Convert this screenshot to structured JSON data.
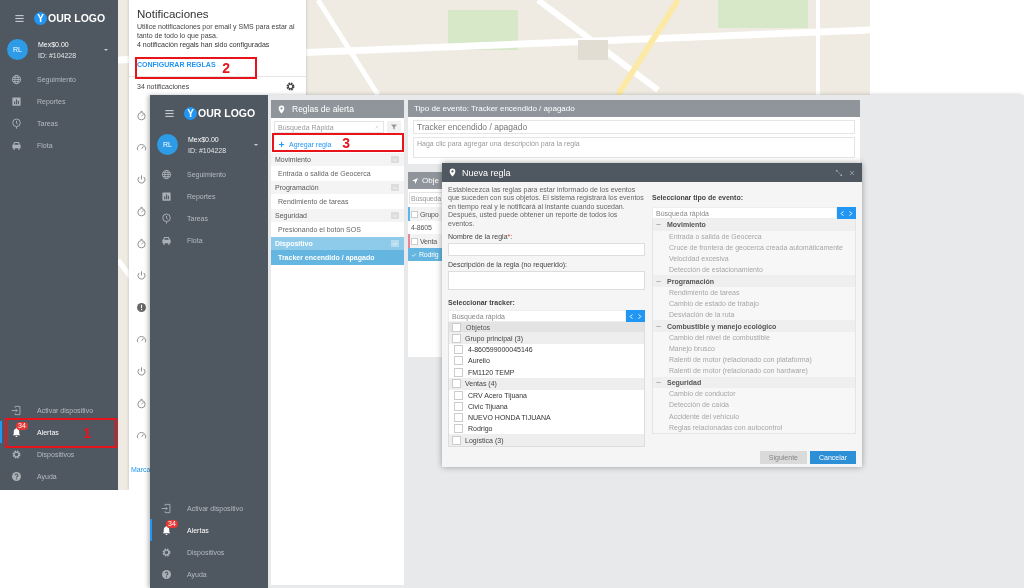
{
  "screen_1": {
    "sidebar": {
      "logo": {
        "mark": "Y",
        "text": "OUR LOGO"
      },
      "account": {
        "initials": "RL",
        "balance": "Mex$0.00",
        "id": "ID: #104228"
      },
      "nav": [
        {
          "label": "Seguimiento",
          "selected": false
        },
        {
          "label": "Reportes",
          "selected": false
        },
        {
          "label": "Tareas",
          "selected": false
        },
        {
          "label": "Flota",
          "selected": false
        }
      ],
      "bottom_nav": [
        {
          "label": "Activar dispositivo",
          "selected": false
        },
        {
          "label": "Alertas",
          "selected": true,
          "badge": "34"
        },
        {
          "label": "Dispositivos",
          "selected": false
        },
        {
          "label": "Ayuda",
          "selected": false
        }
      ]
    },
    "notifications": {
      "title": "Notificaciones",
      "description": "Utilice notificaciones por email y SMS para estar al tanto de todo lo que pasa.",
      "status": "4 notificación regals han sido configuradas",
      "link": "CONFIGURAR REGLAS",
      "count": "34 notificaciones",
      "rows": [
        {
          "kind": "timer"
        },
        {
          "kind": "gauge"
        },
        {
          "kind": "power"
        },
        {
          "kind": "timer"
        },
        {
          "kind": "timer"
        },
        {
          "kind": "power"
        },
        {
          "kind": "info"
        },
        {
          "kind": "gauge"
        },
        {
          "kind": "power"
        },
        {
          "kind": "timer"
        },
        {
          "kind": "gauge"
        }
      ],
      "footer_link": "Marca"
    }
  },
  "screen_2": {
    "sidebar": {
      "logo": {
        "mark": "Y",
        "text": "OUR LOGO"
      },
      "account": {
        "initials": "RL",
        "balance": "Mex$0.00",
        "id": "ID: #104228"
      },
      "nav": [
        {
          "label": "Seguimiento",
          "selected": false
        },
        {
          "label": "Reportes",
          "selected": false
        },
        {
          "label": "Tareas",
          "selected": false
        },
        {
          "label": "Flota",
          "selected": false
        }
      ],
      "bottom_nav": [
        {
          "label": "Activar dispositivo",
          "selected": false
        },
        {
          "label": "Alertas",
          "selected": true,
          "badge": "34"
        },
        {
          "label": "Dispositivos",
          "selected": false
        },
        {
          "label": "Ayuda",
          "selected": false
        }
      ]
    },
    "rules": {
      "title": "Reglas de alerta",
      "search_placeholder": "Búsqueda Rápida",
      "add_label": "Agregar regla",
      "groups": [
        {
          "label": "Movimiento",
          "selected": false,
          "items": [
            {
              "label": "Entrada o salida de Geocerca",
              "selected": false
            }
          ]
        },
        {
          "label": "Programación",
          "selected": false,
          "items": [
            {
              "label": "Rendimiento de tareas",
              "selected": false
            }
          ]
        },
        {
          "label": "Seguridad",
          "selected": false,
          "items": [
            {
              "label": "Presionando el botón SOS",
              "selected": false
            }
          ]
        },
        {
          "label": "Dispositivo",
          "selected": true,
          "items": [
            {
              "label": "Tracker encendido / apagado",
              "selected": true
            }
          ]
        }
      ]
    },
    "event": {
      "title": "Tipo de evento: Tracker encendido / apagado",
      "name_value": "Tracker encendido / apagado",
      "description_placeholder": "Haga clic para agregar una descripción para la regla"
    },
    "objects": {
      "title": "Obje",
      "search_placeholder": "Búsqueda",
      "rows": [
        {
          "kind": "group",
          "label": "Grupo",
          "color": "#5bb5e8",
          "selected": false
        },
        {
          "kind": "item",
          "label": "4-8605",
          "selected": false
        },
        {
          "kind": "group",
          "label": "Venta",
          "color": "#e8849a",
          "selected": false
        },
        {
          "kind": "item",
          "label": "Rodrig",
          "selected": true
        }
      ]
    },
    "modal": {
      "title": "Nueva regla",
      "intro": "Establecezca las reglas para estar informado de los eventos que suceden con sus objetos. El sistema registrará los eventos en tiempo real y le notificará al instante cuando sucedan. Después, usted puede obtener un reporte de todos los eventos.",
      "name_label": "Nombre de la regla",
      "required_mark": "*",
      "name_label_end": ":",
      "description_label": "Descripción de la regla (no requerido):",
      "tracker_label": "Seleccionar tracker:",
      "tracker_search_placeholder": "Búsqueda rápida",
      "objects_header": "Objetos",
      "objects_header_checked": false,
      "tracker_groups": [
        {
          "label": "Grupo principal (3)",
          "checked": false,
          "items": [
            {
              "label": "4-860599000045146",
              "checked": false
            },
            {
              "label": "Aurelio",
              "checked": false
            },
            {
              "label": "FM1120 TEMP",
              "checked": false
            }
          ]
        },
        {
          "label": "Ventas (4)",
          "checked": false,
          "items": [
            {
              "label": "CRV Acero Tijuana",
              "checked": false
            },
            {
              "label": "Civic Tijuana",
              "checked": false
            },
            {
              "label": "NUEVO HONDA TIJUANA",
              "checked": false
            },
            {
              "label": "Rodrigo",
              "checked": false
            }
          ]
        },
        {
          "label": "Logística (3)",
          "checked": false
        }
      ],
      "event_label": "Seleccionar tipo de evento:",
      "event_search_placeholder": "Búsqueda rápida",
      "event_groups": [
        {
          "label": "Movimiento",
          "expanded": true,
          "items": [
            "Entrada o salida de Geocerca",
            "Cruce de frontera de geocerca creada automáticamente",
            "Velocidad excesiva",
            "Detección de estacionamiento"
          ]
        },
        {
          "label": "Programación",
          "expanded": true,
          "items": [
            "Rendimiento de tareas",
            "Cambio de estado de trabajo",
            "Desviación de la ruta"
          ]
        },
        {
          "label": "Combustible y manejo ecológico",
          "expanded": true,
          "items": [
            "Cambio del nivel de combustible",
            "Manejo brusco",
            "Ralentí de motor (relacionado con plataforma)",
            "Ralentí de motor (relacionado con hardware)"
          ]
        },
        {
          "label": "Seguridad",
          "expanded": true,
          "items": [
            "Cambio de conductor",
            "Detección de caída",
            "Accidente del vehículo",
            "Reglas relacionadas con autocontrol"
          ]
        }
      ],
      "buttons": [
        {
          "label": "Siguiente",
          "kind": "secondary",
          "disabled": true
        },
        {
          "label": "Cancelar",
          "kind": "primary",
          "disabled": false
        }
      ]
    }
  },
  "annotations": [
    {
      "number": "1"
    },
    {
      "number": "2"
    },
    {
      "number": "3"
    }
  ]
}
